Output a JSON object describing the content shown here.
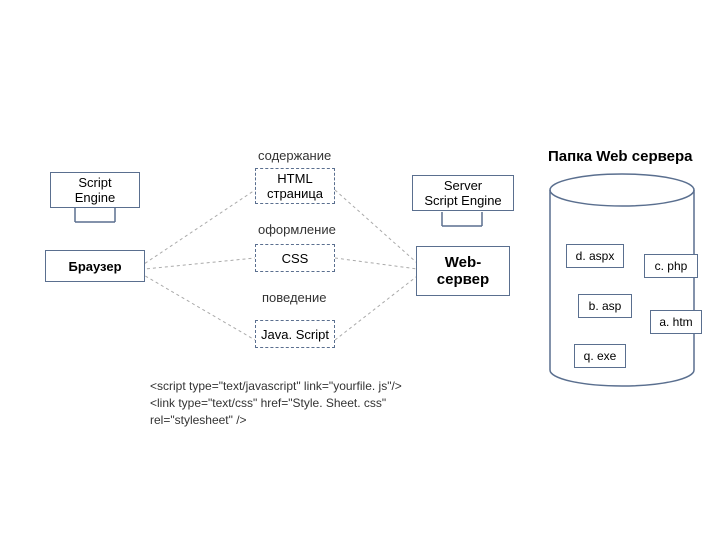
{
  "title": "Папка Web сервера",
  "scriptEngine": "Script\nEngine",
  "browser": "Браузер",
  "contentLabel": "содержание",
  "html": "HTML\nстраница",
  "styleLabel": "оформление",
  "css": "CSS",
  "behaviorLabel": "поведение",
  "js": "Java. Script",
  "serverEngine": "Server\nScript Engine",
  "webserver": "Web-\nсервер",
  "files": {
    "d": "d. aspx",
    "c": "c. php",
    "b": "b. asp",
    "a": "a. htm",
    "q": "q. exe"
  },
  "code": "<script type=\"text/javascript\" link=\"yourfile. js\"/>\n<link type=\"text/css\" href=\"Style. Sheet. css\"\nrel=\"stylesheet\" />"
}
